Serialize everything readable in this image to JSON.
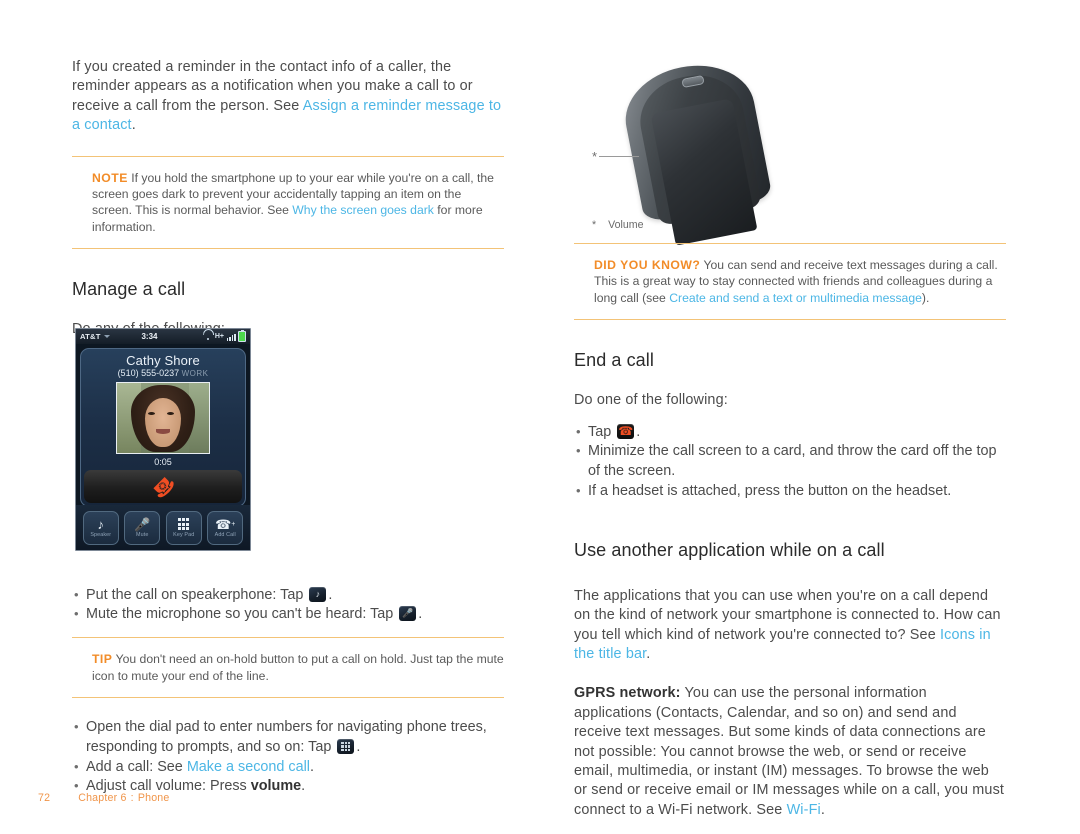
{
  "document": {
    "footer": {
      "page_number": "72",
      "chapter": "Chapter 6",
      "separator": ":",
      "section": "Phone"
    }
  },
  "left_column": {
    "intro_paragraph": {
      "text_before": "If you created a reminder in the contact info of a caller, the reminder appears as a notification when you make a call to or receive a call from the person. See ",
      "link": "Assign a reminder message to a contact",
      "text_after": "."
    },
    "note_box": {
      "label": "NOTE",
      "text_before": "If you hold the smartphone up to your ear while you're on a call, the screen goes dark to prevent your accidentally tapping an item on the screen. This is normal behavior. See ",
      "link": "Why the screen goes dark",
      "text_after": " for more information."
    },
    "heading": "Manage a call",
    "lead_in": "Do any of the following:",
    "call_screen": {
      "status_bar": {
        "carrier": "AT&T",
        "time": "3:34",
        "network_type": "H+"
      },
      "contact_name": "Cathy Shore",
      "phone_number": "(510) 555-0237",
      "number_type": "WORK",
      "call_duration": "0:05",
      "dock_buttons": [
        {
          "label": "Speaker"
        },
        {
          "label": "Mute"
        },
        {
          "label": "Key Pad"
        },
        {
          "label": "Add Call"
        }
      ]
    },
    "bullets_group_1": [
      {
        "text_before": "Put the call on speakerphone: Tap ",
        "icon": "speaker-icon",
        "text_after": "."
      },
      {
        "text_before": "Mute the microphone so you can't be heard: Tap ",
        "icon": "mute-icon",
        "text_after": "."
      }
    ],
    "tip_box": {
      "label": "TIP",
      "text": "You don't need an on-hold button to put a call on hold. Just tap the mute icon to mute your end of the line."
    },
    "bullets_group_2": [
      {
        "text_before": "Open the dial pad to enter numbers for navigating phone trees, responding to prompts, and so on: Tap ",
        "icon": "keypad-icon",
        "text_after": "."
      },
      {
        "text_before": "Add a call: See ",
        "link": "Make a second call",
        "text_after": "."
      },
      {
        "text_before": "Adjust call volume: Press ",
        "bold": "volume",
        "text_after": "."
      }
    ]
  },
  "right_column": {
    "figure": {
      "callout_marker": "*",
      "caption_marker": "*",
      "caption_label": "Volume"
    },
    "did_you_know_box": {
      "label": "DID YOU KNOW?",
      "text_before": "You can send and receive text messages during a call. This is a great way to stay connected with friends and colleagues during a long call (see ",
      "link": "Create and send a text or multimedia message",
      "text_after": ")."
    },
    "end_call": {
      "heading": "End a call",
      "lead_in": "Do one of the following:",
      "bullets": [
        {
          "text_before": "Tap ",
          "icon": "end-call-icon",
          "text_after": "."
        },
        {
          "text_before": "Minimize the call screen to a card, and throw the card off the top of the screen."
        },
        {
          "text_before": "If a headset is attached, press the button on the headset."
        }
      ]
    },
    "use_another_app": {
      "heading": "Use another application while on a call",
      "paragraph_1": {
        "text_before": "The applications that you can use when you're on a call depend on the kind of network your smartphone is connected to. How can you tell which kind of network you're connected to? See ",
        "link": "Icons in the title bar",
        "text_after": "."
      },
      "paragraph_2": {
        "bold_lead": "GPRS network:",
        "text_before": " You can use the personal information applications (Contacts, Calendar, and so on) and send and receive text messages. But some kinds of data connections are not possible: You cannot browse the web, or send or receive email, multimedia, or instant (IM) messages. To browse the web or send or receive email or IM messages while on a call, you must connect to a Wi-Fi network. See ",
        "link": "Wi-Fi",
        "text_after": "."
      }
    }
  },
  "colors": {
    "link": "#4cb6e5",
    "accent_orange": "#f28c28",
    "rule": "#f3c377",
    "body_text": "#4c4c4c",
    "heading": "#2b2b2b",
    "footer": "#f0954a"
  }
}
